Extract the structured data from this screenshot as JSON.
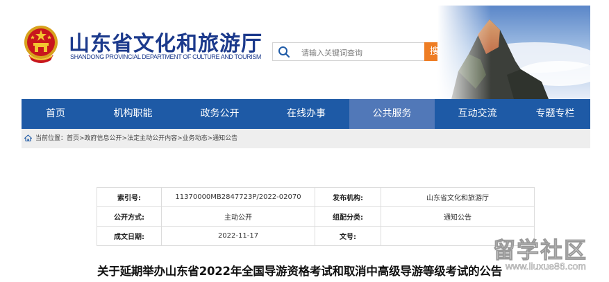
{
  "header": {
    "title": "山东省文化和旅游厅",
    "subtitle": "SHANDONG PROVINCIAL DEPARTMENT OF CULTURE AND TOURISM",
    "emblem_icon": "national-emblem-icon",
    "scenery_image": "mountain-sea-of-clouds-image"
  },
  "search": {
    "placeholder": "请输入关键词查询",
    "button_label": "搜 索",
    "icon": "search-icon",
    "button_color": "#ee7d24"
  },
  "nav": {
    "background_color": "#1e5aa6",
    "active_color": "#5178b8",
    "items": [
      {
        "label": "首页"
      },
      {
        "label": "机构职能"
      },
      {
        "label": "政务公开"
      },
      {
        "label": "在线办事"
      },
      {
        "label": "公共服务",
        "active": true
      },
      {
        "label": "互动交流"
      },
      {
        "label": "专题专栏"
      }
    ]
  },
  "breadcrumb": {
    "icon": "home-icon",
    "text": "当前位置：首页>政府信息公开>法定主动公开内容>业务动态>通知公告"
  },
  "info": {
    "index_label": "索引号:",
    "index_value": "11370000MB2847723P/2022-02070",
    "publisher_label": "发布机构:",
    "publisher_value": "山东省文化和旅游厅",
    "disclosure_label": "公开方式:",
    "disclosure_value": "主动公开",
    "category_label": "组配分类:",
    "category_value": "通知公告",
    "date_label": "成文日期:",
    "date_value": "2022-11-17",
    "docno_label": "文号:",
    "docno_value": ""
  },
  "article": {
    "title": "关于延期举办山东省2022年全国导游资格考试和取消中高级导游等级考试的公告"
  },
  "watermark": {
    "main": "留学社区",
    "sub": "www.liuxue86.com"
  }
}
